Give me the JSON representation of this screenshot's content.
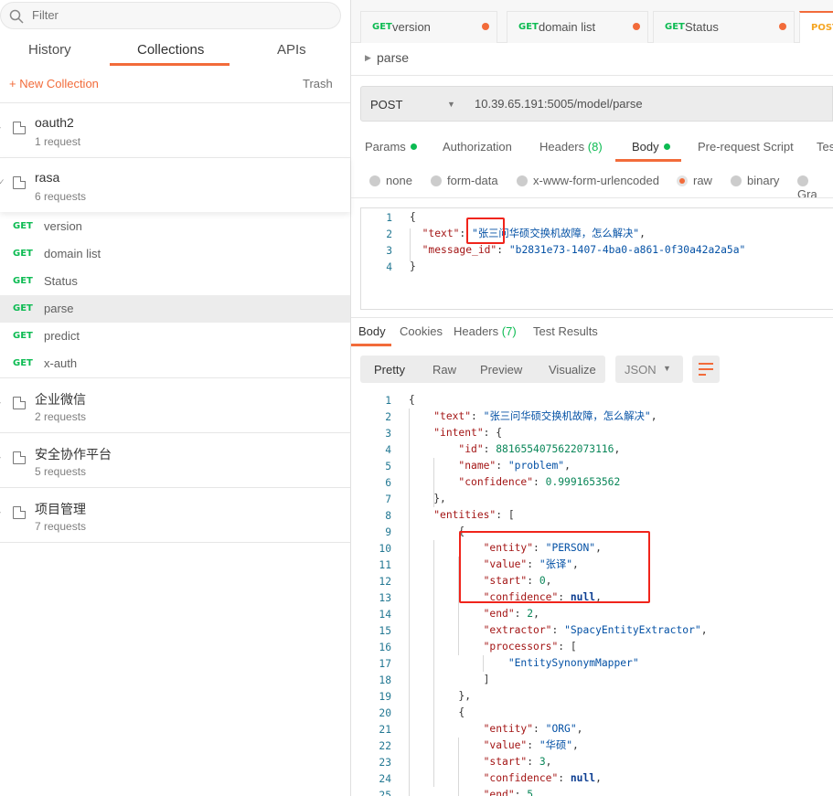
{
  "sidebar": {
    "filter_placeholder": "Filter",
    "tabs": [
      "History",
      "Collections",
      "APIs"
    ],
    "active_tab": "Collections",
    "new_collection": "+ New Collection",
    "trash": "Trash",
    "collections": [
      {
        "name": "oauth2",
        "count": "1 request",
        "expanded": false
      },
      {
        "name": "rasa",
        "count": "6 requests",
        "expanded": true,
        "requests": [
          {
            "method": "GET",
            "name": "version"
          },
          {
            "method": "GET",
            "name": "domain list"
          },
          {
            "method": "GET",
            "name": "Status"
          },
          {
            "method": "GET",
            "name": "parse",
            "selected": true
          },
          {
            "method": "GET",
            "name": "predict"
          },
          {
            "method": "GET",
            "name": "x-auth"
          }
        ]
      },
      {
        "name": "企业微信",
        "count": "2 requests",
        "expanded": false
      },
      {
        "name": "安全协作平台",
        "count": "5 requests",
        "expanded": false
      },
      {
        "name": "项目管理",
        "count": "7 requests",
        "expanded": false
      }
    ]
  },
  "tabs": [
    {
      "method": "GET",
      "name": "version",
      "unsaved": true
    },
    {
      "method": "GET",
      "name": "domain list",
      "unsaved": true
    },
    {
      "method": "GET",
      "name": "Status",
      "unsaved": true
    },
    {
      "method": "POST",
      "name": "",
      "active": true
    }
  ],
  "request": {
    "breadcrumb": "parse",
    "method": "POST",
    "url": "10.39.65.191:5005/model/parse",
    "tabs": [
      {
        "label": "Params",
        "dot": true
      },
      {
        "label": "Authorization"
      },
      {
        "label": "Headers",
        "count": "(8)"
      },
      {
        "label": "Body",
        "dot": true,
        "active": true
      },
      {
        "label": "Pre-request Script"
      },
      {
        "label": "Tes"
      }
    ],
    "body_types": [
      {
        "label": "none"
      },
      {
        "label": "form-data"
      },
      {
        "label": "x-www-form-urlencoded"
      },
      {
        "label": "raw",
        "selected": true
      },
      {
        "label": "binary"
      },
      {
        "label": "Gra"
      }
    ],
    "body_lines": [
      [
        [
          "p",
          "{"
        ]
      ],
      [
        [
          "p",
          "  "
        ],
        [
          "k",
          "\"text\""
        ],
        [
          "p",
          ": "
        ],
        [
          "s",
          "\"张三问华硕交换机故障，怎么解决\""
        ],
        [
          "p",
          ","
        ]
      ],
      [
        [
          "p",
          "  "
        ],
        [
          "k",
          "\"message_id\""
        ],
        [
          "p",
          ": "
        ],
        [
          "s",
          "\"b2831e73-1407-4ba0-a861-0f30a42a2a5a\""
        ]
      ],
      [
        [
          "p",
          "}"
        ]
      ]
    ]
  },
  "response": {
    "tabs": [
      {
        "label": "Body",
        "active": true
      },
      {
        "label": "Cookies"
      },
      {
        "label": "Headers",
        "count": "(7)"
      },
      {
        "label": "Test Results"
      }
    ],
    "views": [
      "Pretty",
      "Raw",
      "Preview",
      "Visualize"
    ],
    "active_view": "Pretty",
    "format": "JSON",
    "wrap_icon": "wrap-lines-icon",
    "lines": [
      [
        [
          "p",
          "{"
        ]
      ],
      [
        [
          "p",
          "    "
        ],
        [
          "k",
          "\"text\""
        ],
        [
          "p",
          ": "
        ],
        [
          "s",
          "\"张三问华硕交换机故障，怎么解决\""
        ],
        [
          "p",
          ","
        ]
      ],
      [
        [
          "p",
          "    "
        ],
        [
          "k",
          "\"intent\""
        ],
        [
          "p",
          ": {"
        ]
      ],
      [
        [
          "p",
          "        "
        ],
        [
          "k",
          "\"id\""
        ],
        [
          "p",
          ": "
        ],
        [
          "num",
          "8816554075622073116"
        ],
        [
          "p",
          ","
        ]
      ],
      [
        [
          "p",
          "        "
        ],
        [
          "k",
          "\"name\""
        ],
        [
          "p",
          ": "
        ],
        [
          "s",
          "\"problem\""
        ],
        [
          "p",
          ","
        ]
      ],
      [
        [
          "p",
          "        "
        ],
        [
          "k",
          "\"confidence\""
        ],
        [
          "p",
          ": "
        ],
        [
          "num",
          "0.9991653562"
        ]
      ],
      [
        [
          "p",
          "    },"
        ]
      ],
      [
        [
          "p",
          "    "
        ],
        [
          "k",
          "\"entities\""
        ],
        [
          "p",
          ": ["
        ]
      ],
      [
        [
          "p",
          "        {"
        ]
      ],
      [
        [
          "p",
          "            "
        ],
        [
          "k",
          "\"entity\""
        ],
        [
          "p",
          ": "
        ],
        [
          "s",
          "\"PERSON\""
        ],
        [
          "p",
          ","
        ]
      ],
      [
        [
          "p",
          "            "
        ],
        [
          "k",
          "\"value\""
        ],
        [
          "p",
          ": "
        ],
        [
          "s",
          "\"张译\""
        ],
        [
          "p",
          ","
        ]
      ],
      [
        [
          "p",
          "            "
        ],
        [
          "k",
          "\"start\""
        ],
        [
          "p",
          ": "
        ],
        [
          "num",
          "0"
        ],
        [
          "p",
          ","
        ]
      ],
      [
        [
          "p",
          "            "
        ],
        [
          "k",
          "\"confidence\""
        ],
        [
          "p",
          ": "
        ],
        [
          "nl",
          "null"
        ],
        [
          "p",
          ","
        ]
      ],
      [
        [
          "p",
          "            "
        ],
        [
          "k",
          "\"end\""
        ],
        [
          "p",
          ": "
        ],
        [
          "num",
          "2"
        ],
        [
          "p",
          ","
        ]
      ],
      [
        [
          "p",
          "            "
        ],
        [
          "k",
          "\"extractor\""
        ],
        [
          "p",
          ": "
        ],
        [
          "s",
          "\"SpacyEntityExtractor\""
        ],
        [
          "p",
          ","
        ]
      ],
      [
        [
          "p",
          "            "
        ],
        [
          "k",
          "\"processors\""
        ],
        [
          "p",
          ": ["
        ]
      ],
      [
        [
          "p",
          "                "
        ],
        [
          "s",
          "\"EntitySynonymMapper\""
        ]
      ],
      [
        [
          "p",
          "            ]"
        ]
      ],
      [
        [
          "p",
          "        },"
        ]
      ],
      [
        [
          "p",
          "        {"
        ]
      ],
      [
        [
          "p",
          "            "
        ],
        [
          "k",
          "\"entity\""
        ],
        [
          "p",
          ": "
        ],
        [
          "s",
          "\"ORG\""
        ],
        [
          "p",
          ","
        ]
      ],
      [
        [
          "p",
          "            "
        ],
        [
          "k",
          "\"value\""
        ],
        [
          "p",
          ": "
        ],
        [
          "s",
          "\"华硕\""
        ],
        [
          "p",
          ","
        ]
      ],
      [
        [
          "p",
          "            "
        ],
        [
          "k",
          "\"start\""
        ],
        [
          "p",
          ": "
        ],
        [
          "num",
          "3"
        ],
        [
          "p",
          ","
        ]
      ],
      [
        [
          "p",
          "            "
        ],
        [
          "k",
          "\"confidence\""
        ],
        [
          "p",
          ": "
        ],
        [
          "nl",
          "null"
        ],
        [
          "p",
          ","
        ]
      ],
      [
        [
          "p",
          "            "
        ],
        [
          "k",
          "\"end\""
        ],
        [
          "p",
          ": "
        ],
        [
          "num",
          "5"
        ]
      ]
    ]
  },
  "colors": {
    "accent": "#f26b3a",
    "get": "#0cbb52",
    "post": "#f5a623",
    "annotation": "#f0241b"
  }
}
